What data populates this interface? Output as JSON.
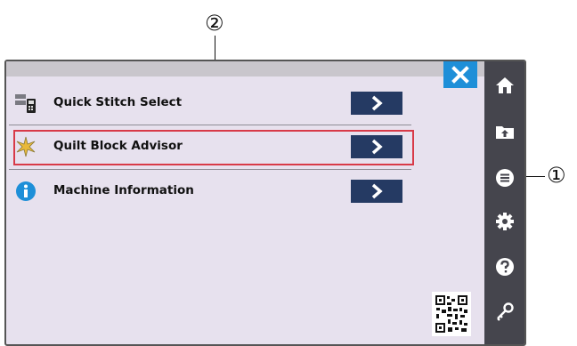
{
  "callouts": {
    "two": "②",
    "one": "①"
  },
  "window": {
    "close_icon": "close-x",
    "menu": [
      {
        "label": "Quick Stitch Select",
        "icon": "stitch-select-icon"
      },
      {
        "label": "Quilt Block Advisor",
        "icon": "quilt-block-icon"
      },
      {
        "label": "Machine Information",
        "icon": "info-icon"
      }
    ],
    "sidebar": [
      "home",
      "folder-upload",
      "menu",
      "settings",
      "help",
      "key"
    ],
    "qr_code": "qr-code"
  },
  "colors": {
    "accent_blue": "#1e8fd8",
    "button_navy": "#253a63",
    "sidebar_bg": "#45454d",
    "highlight_red": "#d83a48",
    "panel_bg": "#e7e1ee"
  }
}
